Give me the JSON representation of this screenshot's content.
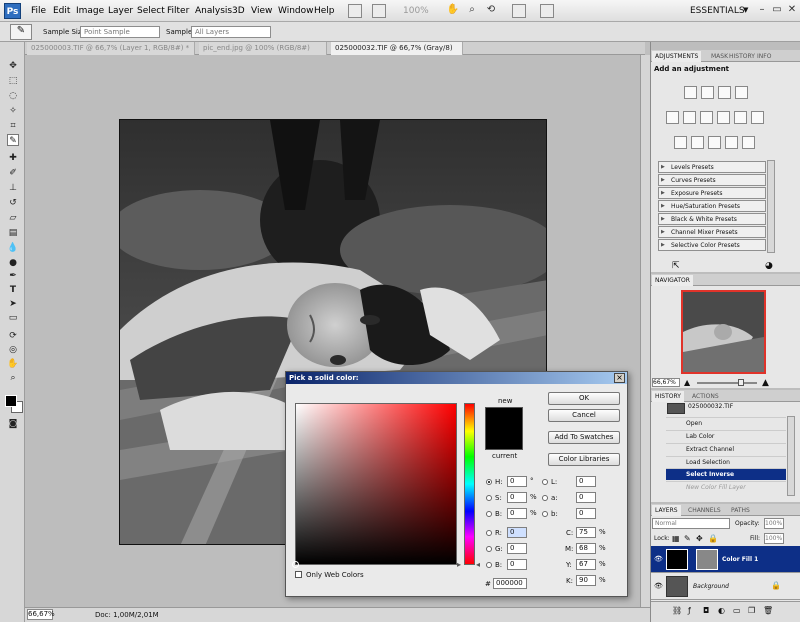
{
  "app": {
    "logo": "Ps"
  },
  "menu": [
    "File",
    "Edit",
    "Image",
    "Layer",
    "Select",
    "Filter",
    "Analysis",
    "3D",
    "View",
    "Window",
    "Help"
  ],
  "zoom_readout": "100%",
  "workspace": "ESSENTIALS",
  "options": {
    "sample_size_label": "Sample Size:",
    "sample_size_value": "Point Sample",
    "sample_label": "Sample:",
    "sample_value": "All Layers"
  },
  "tabs": [
    "025000003.TIF @ 66,7% (Layer 1, RGB/8#) *",
    "pic_end.jpg @ 100% (RGB/8#)",
    "025000032.TIF @ 66,7% (Gray/8) *"
  ],
  "status": {
    "zoom": "66,67%",
    "doc": "Doc: 1,00M/2,01M"
  },
  "adjustments": {
    "tabs": [
      "ADJUSTMENTS",
      "MASK",
      "HISTORY",
      "INFO"
    ],
    "heading": "Add an adjustment",
    "presets": [
      "Levels Presets",
      "Curves Presets",
      "Exposure Presets",
      "Hue/Saturation Presets",
      "Black & White Presets",
      "Channel Mixer Presets",
      "Selective Color Presets"
    ]
  },
  "navigator": {
    "tab": "NAVIGATOR",
    "zoom": "66,67%"
  },
  "history": {
    "tabs": [
      "HISTORY",
      "ACTIONS"
    ],
    "snapshot": "025000032.TIF",
    "items": [
      "Open",
      "Lab Color",
      "Extract Channel",
      "Load Selection",
      "Select Inverse",
      "New Color Fill Layer"
    ]
  },
  "layers": {
    "tabs": [
      "LAYERS",
      "CHANNELS",
      "PATHS"
    ],
    "blend": "Normal",
    "opacity_label": "Opacity:",
    "opacity": "100%",
    "lock_label": "Lock:",
    "fill_label": "Fill:",
    "fill": "100%",
    "items": [
      "Color Fill 1",
      "Background"
    ]
  },
  "dialog": {
    "title": "Pick a solid color:",
    "new_label": "new",
    "current_label": "current",
    "ok": "OK",
    "cancel": "Cancel",
    "add_swatches": "Add To Swatches",
    "color_libraries": "Color Libraries",
    "web_only": "Only Web Colors",
    "new_color": "#000000",
    "current_color": "#000000",
    "fields": {
      "H": "0",
      "S": "0",
      "Bv": "0",
      "R": "0",
      "G": "0",
      "B": "0",
      "L": "0",
      "a": "0",
      "b": "0",
      "C": "75",
      "M": "68",
      "Y": "67",
      "K": "90",
      "hex": "000000"
    },
    "units": {
      "deg": "°",
      "pct": "%"
    }
  }
}
